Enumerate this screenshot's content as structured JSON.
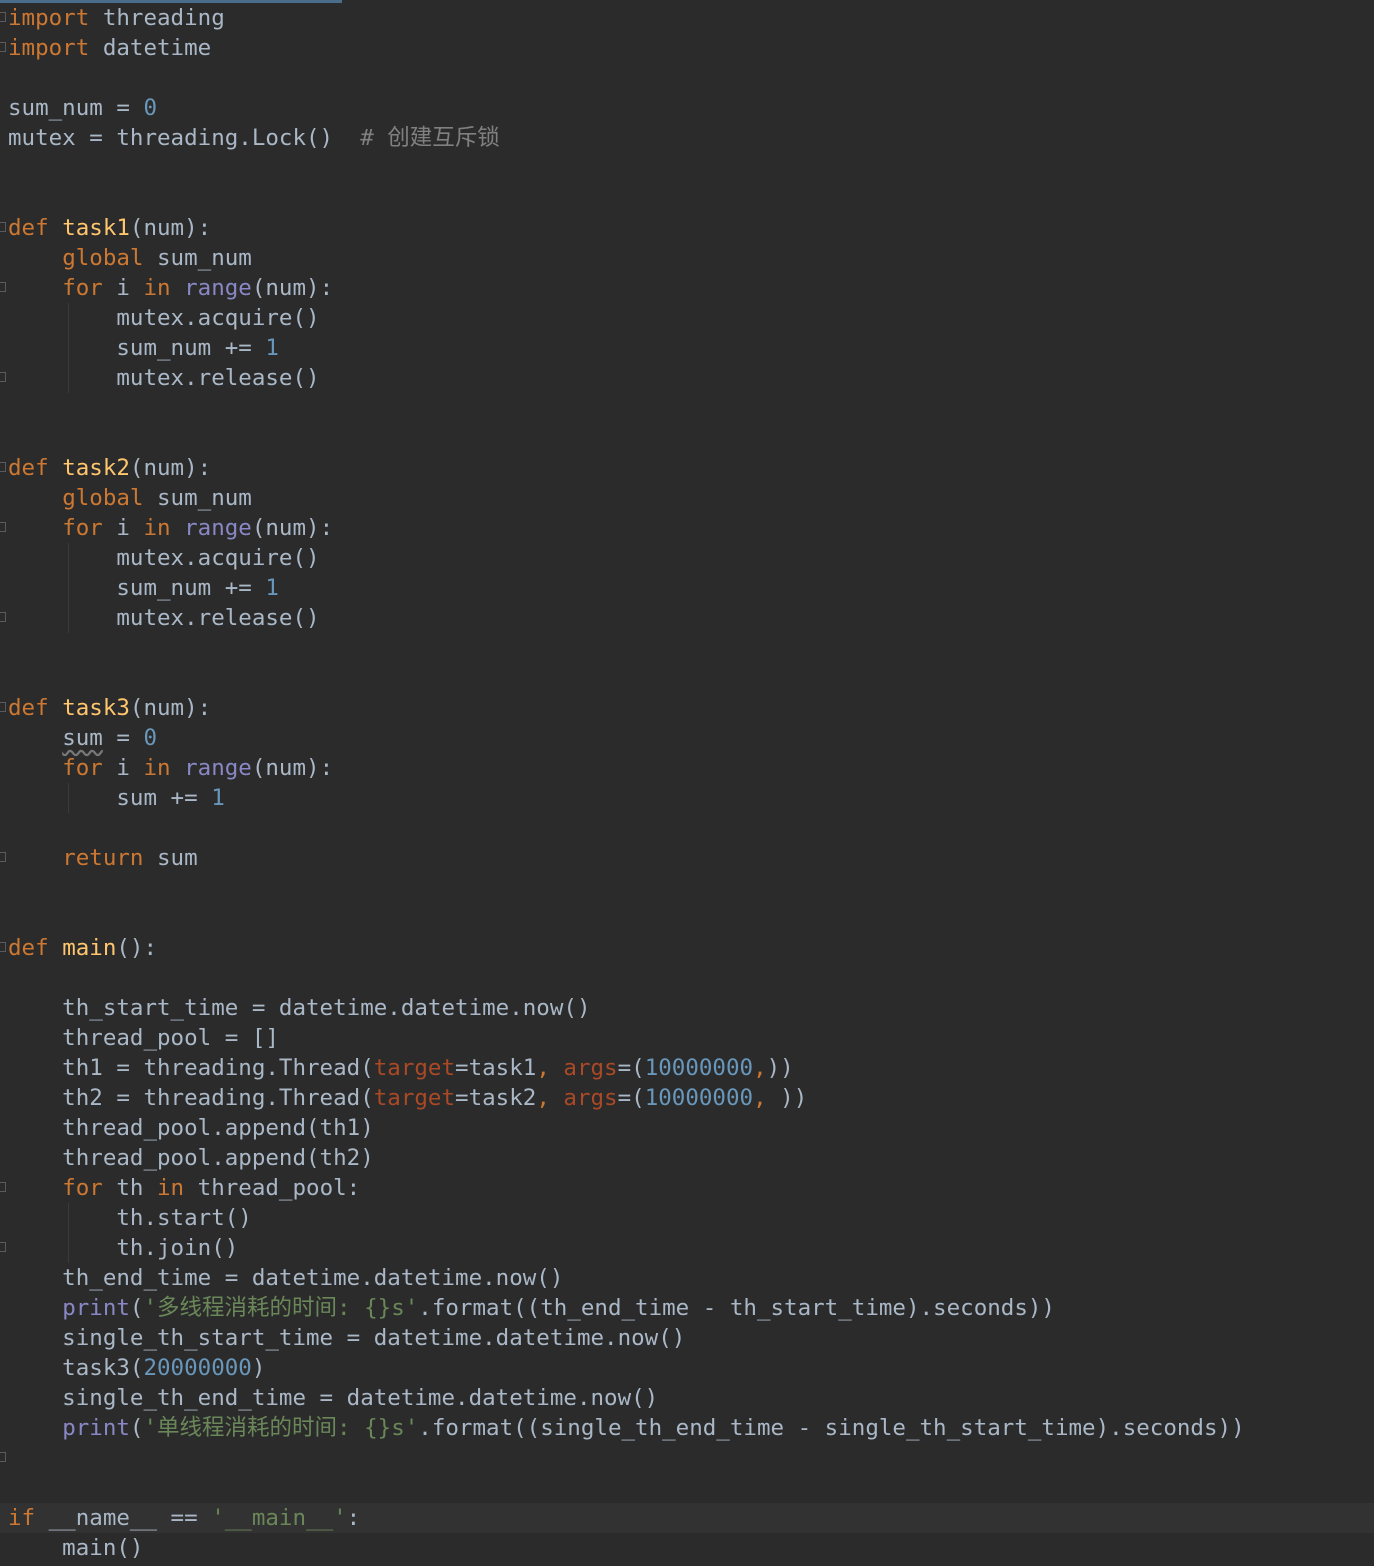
{
  "editor": {
    "language": "python",
    "theme_colors": {
      "background": "#2b2b2b",
      "keyword": "#cc7832",
      "function_def": "#ffc66d",
      "number": "#6897bb",
      "comment": "#808080",
      "builtin": "#8888c6",
      "string": "#6a8759",
      "param": "#aa4926",
      "default_text": "#a9b7c6"
    },
    "lines": [
      {
        "tokens": [
          [
            "k",
            "import"
          ],
          [
            "t",
            " threading"
          ]
        ]
      },
      {
        "tokens": [
          [
            "k",
            "import"
          ],
          [
            "t",
            " datetime"
          ]
        ]
      },
      {
        "tokens": []
      },
      {
        "tokens": [
          [
            "t",
            "sum_num = "
          ],
          [
            "n",
            "0"
          ]
        ]
      },
      {
        "tokens": [
          [
            "t",
            "mutex = threading.Lock()  "
          ],
          [
            "c",
            "# 创建互斥锁"
          ]
        ]
      },
      {
        "tokens": []
      },
      {
        "tokens": []
      },
      {
        "tokens": [
          [
            "k",
            "def"
          ],
          [
            "t",
            " "
          ],
          [
            "fn",
            "task1"
          ],
          [
            "t",
            "(num):"
          ]
        ]
      },
      {
        "tokens": [
          [
            "t",
            "    "
          ],
          [
            "k",
            "global"
          ],
          [
            "t",
            " sum_num"
          ]
        ]
      },
      {
        "tokens": [
          [
            "t",
            "    "
          ],
          [
            "k",
            "for"
          ],
          [
            "t",
            " i "
          ],
          [
            "k",
            "in"
          ],
          [
            "t",
            " "
          ],
          [
            "b",
            "range"
          ],
          [
            "t",
            "(num):"
          ]
        ]
      },
      {
        "tokens": [
          [
            "t",
            "        mutex.acquire()"
          ]
        ]
      },
      {
        "tokens": [
          [
            "t",
            "        sum_num += "
          ],
          [
            "n",
            "1"
          ]
        ]
      },
      {
        "tokens": [
          [
            "t",
            "        mutex.release()"
          ]
        ]
      },
      {
        "tokens": []
      },
      {
        "tokens": []
      },
      {
        "tokens": [
          [
            "k",
            "def"
          ],
          [
            "t",
            " "
          ],
          [
            "fn",
            "task2"
          ],
          [
            "t",
            "(num):"
          ]
        ]
      },
      {
        "tokens": [
          [
            "t",
            "    "
          ],
          [
            "k",
            "global"
          ],
          [
            "t",
            " sum_num"
          ]
        ]
      },
      {
        "tokens": [
          [
            "t",
            "    "
          ],
          [
            "k",
            "for"
          ],
          [
            "t",
            " i "
          ],
          [
            "k",
            "in"
          ],
          [
            "t",
            " "
          ],
          [
            "b",
            "range"
          ],
          [
            "t",
            "(num):"
          ]
        ]
      },
      {
        "tokens": [
          [
            "t",
            "        mutex.acquire()"
          ]
        ]
      },
      {
        "tokens": [
          [
            "t",
            "        sum_num += "
          ],
          [
            "n",
            "1"
          ]
        ]
      },
      {
        "tokens": [
          [
            "t",
            "        mutex.release()"
          ]
        ]
      },
      {
        "tokens": []
      },
      {
        "tokens": []
      },
      {
        "tokens": [
          [
            "k",
            "def"
          ],
          [
            "t",
            " "
          ],
          [
            "fn",
            "task3"
          ],
          [
            "t",
            "(num):"
          ]
        ]
      },
      {
        "tokens": [
          [
            "t",
            "    "
          ],
          [
            "w",
            "sum"
          ],
          [
            "t",
            " = "
          ],
          [
            "n",
            "0"
          ]
        ]
      },
      {
        "tokens": [
          [
            "t",
            "    "
          ],
          [
            "k",
            "for"
          ],
          [
            "t",
            " i "
          ],
          [
            "k",
            "in"
          ],
          [
            "t",
            " "
          ],
          [
            "b",
            "range"
          ],
          [
            "t",
            "(num):"
          ]
        ]
      },
      {
        "tokens": [
          [
            "t",
            "        sum += "
          ],
          [
            "n",
            "1"
          ]
        ]
      },
      {
        "tokens": []
      },
      {
        "tokens": [
          [
            "t",
            "    "
          ],
          [
            "k",
            "return"
          ],
          [
            "t",
            " sum"
          ]
        ]
      },
      {
        "tokens": []
      },
      {
        "tokens": []
      },
      {
        "tokens": [
          [
            "k",
            "def"
          ],
          [
            "t",
            " "
          ],
          [
            "fn",
            "main"
          ],
          [
            "t",
            "():"
          ]
        ]
      },
      {
        "tokens": []
      },
      {
        "tokens": [
          [
            "t",
            "    th_start_time = datetime.datetime.now()"
          ]
        ]
      },
      {
        "tokens": [
          [
            "t",
            "    thread_pool = []"
          ]
        ]
      },
      {
        "tokens": [
          [
            "t",
            "    th1 = threading.Thread("
          ],
          [
            "p",
            "target"
          ],
          [
            "t",
            "=task1"
          ],
          [
            "k",
            ", "
          ],
          [
            "p",
            "args"
          ],
          [
            "t",
            "=("
          ],
          [
            "n",
            "10000000"
          ],
          [
            "k",
            ","
          ],
          [
            "t",
            "))"
          ]
        ]
      },
      {
        "tokens": [
          [
            "t",
            "    th2 = threading.Thread("
          ],
          [
            "p",
            "target"
          ],
          [
            "t",
            "=task2"
          ],
          [
            "k",
            ", "
          ],
          [
            "p",
            "args"
          ],
          [
            "t",
            "=("
          ],
          [
            "n",
            "10000000"
          ],
          [
            "k",
            ", "
          ],
          [
            "t",
            "))"
          ]
        ]
      },
      {
        "tokens": [
          [
            "t",
            "    thread_pool.append(th1)"
          ]
        ]
      },
      {
        "tokens": [
          [
            "t",
            "    thread_pool.append(th2)"
          ]
        ]
      },
      {
        "tokens": [
          [
            "t",
            "    "
          ],
          [
            "k",
            "for"
          ],
          [
            "t",
            " th "
          ],
          [
            "k",
            "in"
          ],
          [
            "t",
            " thread_pool:"
          ]
        ]
      },
      {
        "tokens": [
          [
            "t",
            "        th.start()"
          ]
        ]
      },
      {
        "tokens": [
          [
            "t",
            "        th.join()"
          ]
        ]
      },
      {
        "tokens": [
          [
            "t",
            "    th_end_time = datetime.datetime.now()"
          ]
        ]
      },
      {
        "tokens": [
          [
            "t",
            "    "
          ],
          [
            "b",
            "print"
          ],
          [
            "t",
            "("
          ],
          [
            "s",
            "'多线程消耗的时间: {}s'"
          ],
          [
            "t",
            ".format((th_end_time - th_start_time).seconds))"
          ]
        ]
      },
      {
        "tokens": [
          [
            "t",
            "    single_th_start_time = datetime.datetime.now()"
          ]
        ]
      },
      {
        "tokens": [
          [
            "t",
            "    task3("
          ],
          [
            "n",
            "20000000"
          ],
          [
            "t",
            ")"
          ]
        ]
      },
      {
        "tokens": [
          [
            "t",
            "    single_th_end_time = datetime.datetime.now()"
          ]
        ]
      },
      {
        "tokens": [
          [
            "t",
            "    "
          ],
          [
            "b",
            "print"
          ],
          [
            "t",
            "("
          ],
          [
            "s",
            "'单线程消耗的时间: {}s'"
          ],
          [
            "t",
            ".format((single_th_end_time - single_th_start_time).seconds))"
          ]
        ]
      },
      {
        "tokens": []
      },
      {
        "tokens": []
      },
      {
        "tokens": [
          [
            "k",
            "if"
          ],
          [
            "t",
            " __name__ == "
          ],
          [
            "s",
            "'__main__'"
          ],
          [
            "t",
            ":"
          ]
        ]
      },
      {
        "tokens": [
          [
            "t",
            "    main()"
          ]
        ]
      }
    ]
  }
}
